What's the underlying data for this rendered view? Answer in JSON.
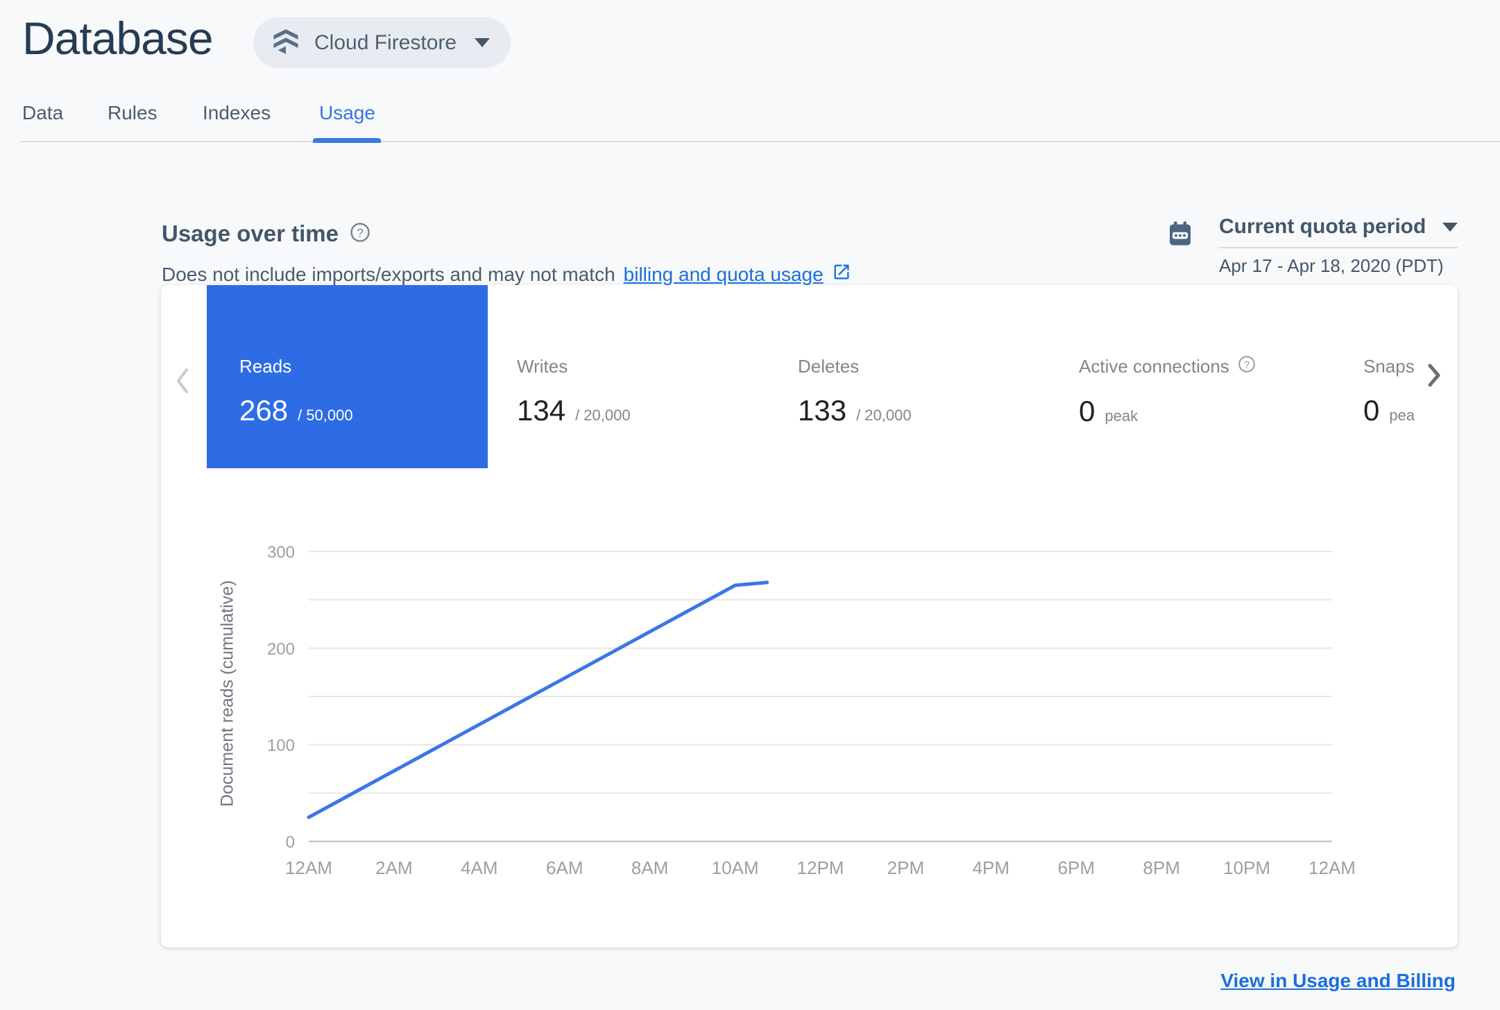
{
  "app": {
    "title": "Database",
    "product": "Cloud Firestore"
  },
  "tabs": {
    "items": [
      {
        "label": "Data",
        "active": false
      },
      {
        "label": "Rules",
        "active": false
      },
      {
        "label": "Indexes",
        "active": false
      },
      {
        "label": "Usage",
        "active": true
      }
    ]
  },
  "usage_header": {
    "title": "Usage over time",
    "subtitle_prefix": "Does not include imports/exports and may not match",
    "subtitle_link_text": "billing and quota usage",
    "period": {
      "selector_label": "Current quota period",
      "range_label": "Apr 17 - Apr 18, 2020 (PDT)"
    }
  },
  "metrics": {
    "items": [
      {
        "label": "Reads",
        "value": "268",
        "quota": "/ 50,000",
        "selected": true,
        "has_help": false
      },
      {
        "label": "Writes",
        "value": "134",
        "quota": "/ 20,000",
        "selected": false,
        "has_help": false
      },
      {
        "label": "Deletes",
        "value": "133",
        "quota": "/ 20,000",
        "selected": false,
        "has_help": false
      },
      {
        "label": "Active connections",
        "value": "0",
        "quota": "peak",
        "selected": false,
        "has_help": true
      },
      {
        "label": "Snapsho",
        "value": "0",
        "quota": "peak",
        "selected": false,
        "has_help": false,
        "truncated": true
      }
    ]
  },
  "chart_data": {
    "type": "line",
    "title": "",
    "xlabel": "",
    "ylabel": "Document reads (cumulative)",
    "ylim": [
      0,
      300
    ],
    "xlim_hours": [
      0,
      24
    ],
    "y_major_ticks": [
      0,
      100,
      200,
      300
    ],
    "y_gridline_step": 50,
    "x_tick_hours": [
      0,
      2,
      4,
      6,
      8,
      10,
      12,
      14,
      16,
      18,
      20,
      22,
      24
    ],
    "x_tick_labels": [
      "12AM",
      "2AM",
      "4AM",
      "6AM",
      "8AM",
      "10AM",
      "12PM",
      "2PM",
      "4PM",
      "6PM",
      "8PM",
      "10PM",
      "12AM"
    ],
    "grid": true,
    "legend": "none",
    "series": [
      {
        "name": "Document reads (cumulative)",
        "color": "#3c76e6",
        "points_hour_value": [
          [
            0,
            25
          ],
          [
            10,
            265
          ],
          [
            10.75,
            268
          ]
        ]
      }
    ]
  },
  "footer": {
    "link_label": "View in Usage and Billing"
  },
  "colors": {
    "page_bg": "#f8f9fa",
    "title_navy": "#263c55",
    "accent_blue": "#3574e2",
    "tile_selected_bg": "#2d6ce4",
    "line_blue": "#3c76e6",
    "link_blue": "#1a6fdb",
    "gridline": "#e6e6e6",
    "axis_baseline": "#c5c7ca",
    "tick_text": "#9aa0a6"
  }
}
